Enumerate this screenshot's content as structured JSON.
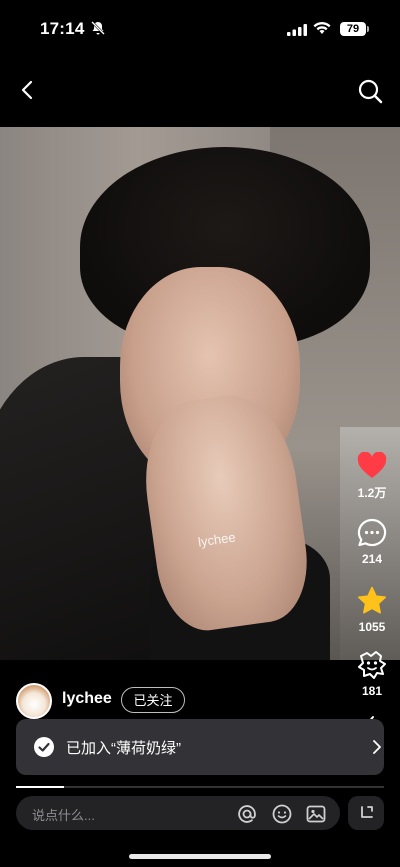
{
  "status_bar": {
    "time": "17:14",
    "battery": "79"
  },
  "post": {
    "watermark": "lychee",
    "author": "lychee",
    "follow_label": "已关注",
    "progress": 0.13
  },
  "actions": {
    "likes": "1.2万",
    "comments": "214",
    "favorites": "1055",
    "shares": "181"
  },
  "toast": {
    "text": "已加入“薄荷奶绿”"
  },
  "comment_box": {
    "placeholder": "说点什么..."
  },
  "colors": {
    "like": "#ff3b45",
    "star": "#ffc21a"
  }
}
